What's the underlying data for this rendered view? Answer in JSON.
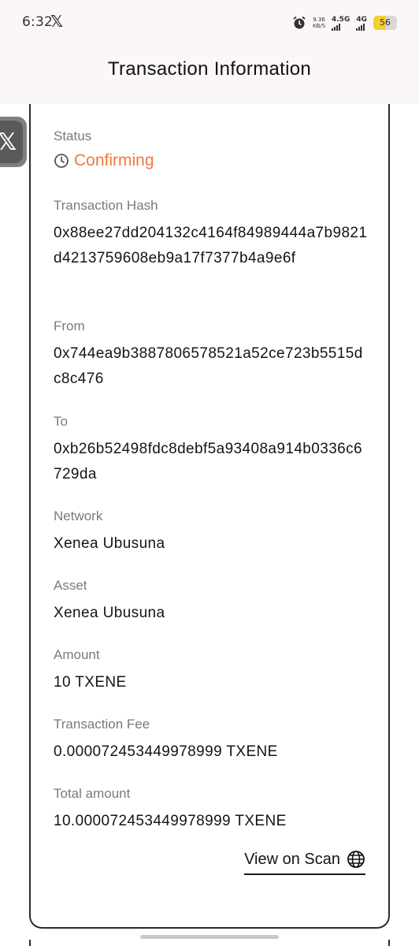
{
  "status_bar": {
    "time": "6:32",
    "net_speed_value": "9.36",
    "net_speed_unit": "KB/S",
    "network_1": "4.5G",
    "network_2": "4G",
    "battery_level": "56"
  },
  "header": {
    "title": "Transaction Information"
  },
  "transaction": {
    "status": {
      "label": "Status",
      "value": "Confirming",
      "color": "#f07a3c"
    },
    "hash": {
      "label": "Transaction Hash",
      "value": "0x88ee27dd204132c4164f84989444a7b9821d4213759608eb9a17f7377b4a9e6f"
    },
    "from": {
      "label": "From",
      "value": "0x744ea9b3887806578521a52ce723b5515dc8c476"
    },
    "to": {
      "label": "To",
      "value": "0xb26b52498fdc8debf5a93408a914b0336c6729da"
    },
    "network": {
      "label": "Network",
      "value": "Xenea Ubusuna"
    },
    "asset": {
      "label": "Asset",
      "value": "Xenea Ubusuna"
    },
    "amount": {
      "label": "Amount",
      "value": "10 TXENE"
    },
    "fee": {
      "label": "Transaction Fee",
      "value": "0.000072453449978999 TXENE"
    },
    "total": {
      "label": "Total amount",
      "value": "10.000072453449978999 TXENE"
    }
  },
  "actions": {
    "view_on_scan": "View on Scan"
  },
  "icons": {
    "status_icon": "clock-icon",
    "scan_icon": "globe-icon",
    "floating_app": "x-logo-icon"
  }
}
